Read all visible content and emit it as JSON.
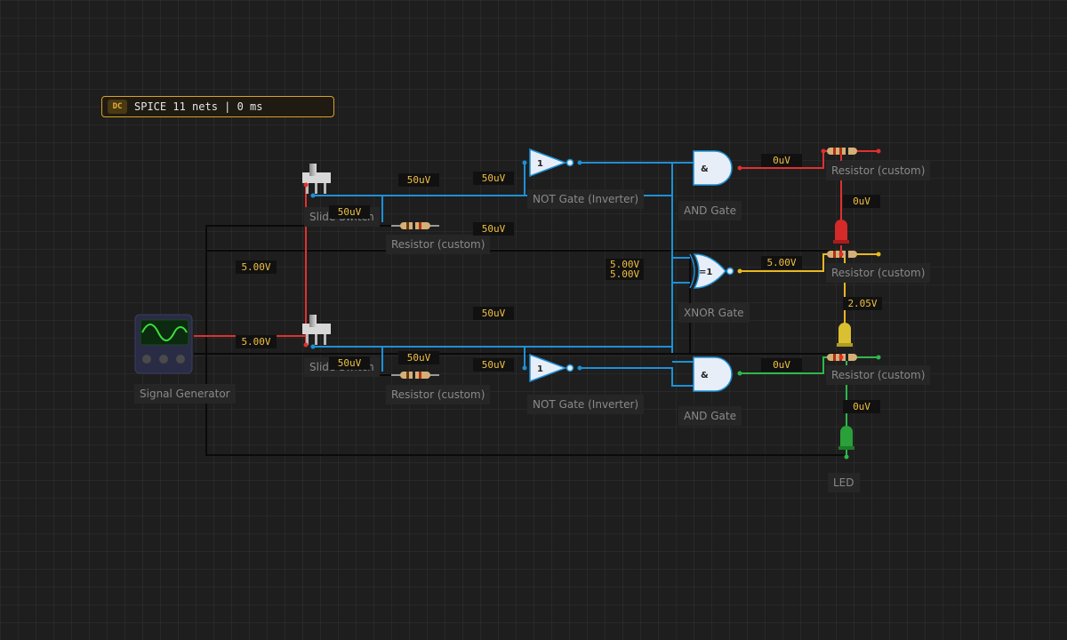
{
  "status": {
    "badge": "DC",
    "text": "SPICE 11 nets | 0 ms"
  },
  "components": {
    "signal_generator": "Signal Generator",
    "slide_switch_1": "Slide Switch",
    "slide_switch_2": "Slide Switch",
    "resistor_1": "Resistor (custom)",
    "resistor_2": "Resistor (custom)",
    "not_gate_1": "NOT Gate (Inverter)",
    "not_gate_2": "NOT Gate (Inverter)",
    "and_gate_1": "AND Gate",
    "and_gate_2": "AND Gate",
    "xnor_gate": "XNOR Gate",
    "resistor_3": "Resistor (custom)",
    "resistor_4": "Resistor (custom)",
    "resistor_5": "Resistor (custom)",
    "led": "LED"
  },
  "gate_symbols": {
    "not": "1",
    "and": "&",
    "xnor": "=1"
  },
  "voltages": {
    "v1": "50uV",
    "v2": "50uV",
    "v3": "50uV",
    "v4": "50uV",
    "v5": "5.00V",
    "v6": "5.00V",
    "v7": "5.00V",
    "v8": "5.00V",
    "v9": "50uV",
    "v10": "5.00V",
    "v11": "50uV",
    "v12": "50uV",
    "v13": "50uV",
    "v14": "0uV",
    "v15": "0uV",
    "v16": "2.05V",
    "v17": "0uV",
    "v18": "0uV"
  },
  "colors": {
    "blue_wire": "#1e90d6",
    "red_wire": "#e03030",
    "yellow_wire": "#e8b820",
    "green_wire": "#2eb84a",
    "black_wire": "#0a0a0a",
    "accent": "#d9a024"
  }
}
